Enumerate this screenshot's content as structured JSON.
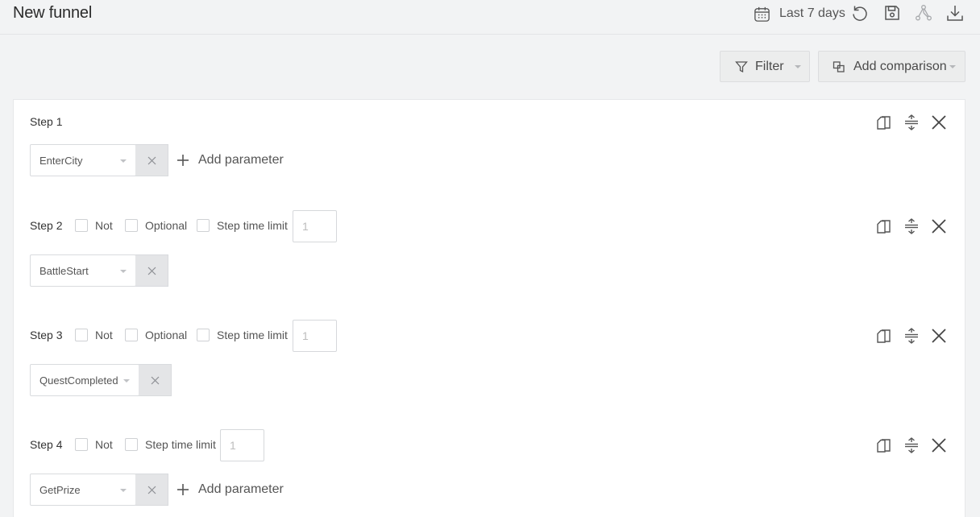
{
  "header": {
    "title": "New funnel",
    "date_range": "Last 7 days"
  },
  "controls": {
    "filter_label": "Filter",
    "comparison_label": "Add comparison"
  },
  "steps": [
    {
      "label": "Step 1",
      "event": "EnterCity",
      "add_param": "Add parameter"
    },
    {
      "label": "Step 2",
      "event": "BattleStart",
      "not_label": "Not",
      "optional_label": "Optional",
      "time_limit_label": "Step time limit",
      "time_limit_placeholder": "1"
    },
    {
      "label": "Step 3",
      "event": "QuestCompleted",
      "not_label": "Not",
      "optional_label": "Optional",
      "time_limit_label": "Step time limit",
      "time_limit_placeholder": "1"
    },
    {
      "label": "Step 4",
      "event": "GetPrize",
      "not_label": "Not",
      "time_limit_label": "Step time limit",
      "time_limit_placeholder": "1",
      "add_param": "Add parameter"
    }
  ],
  "icons": {
    "date": "calendar-icon",
    "reset": "undo-icon",
    "save": "save-icon",
    "share": "share-nodes-icon",
    "download": "download-icon",
    "filter": "funnel-icon",
    "comparison": "compare-icon",
    "copy": "copy-icon",
    "collapse": "collapse-icon",
    "remove": "close-icon"
  },
  "colors": {
    "background": "#f2f3f4",
    "panel": "#ffffff",
    "text": "#333333"
  }
}
